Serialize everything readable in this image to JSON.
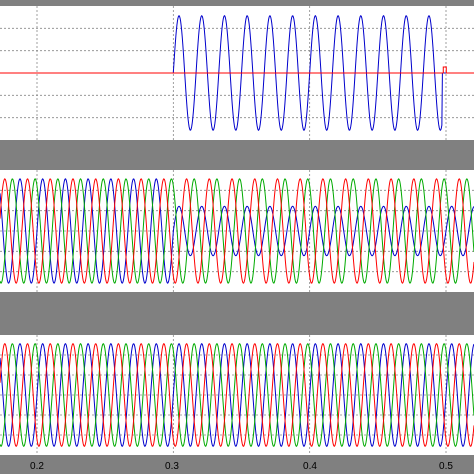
{
  "chart_data": [
    {
      "type": "line",
      "panel": "top",
      "title": "",
      "xlabel": "",
      "ylabel": "",
      "xlim": [
        0.145,
        0.53
      ],
      "ylim": [
        -1,
        1
      ],
      "grid": true,
      "series": [
        {
          "color": "#0000cc",
          "kind": "burst-sine",
          "start": 0.3,
          "end": 0.497,
          "freq_hz": 60,
          "amplitude": 0.95,
          "baseline": 0.0
        },
        {
          "color": "#ff0000",
          "kind": "step",
          "level": 0.0,
          "step_at": 0.498,
          "step_to": 0.1
        }
      ]
    },
    {
      "type": "line",
      "panel": "middle",
      "title": "",
      "xlabel": "",
      "ylabel": "",
      "xlim": [
        0.145,
        0.53
      ],
      "ylim": [
        -1,
        1
      ],
      "grid": true,
      "series": [
        {
          "color": "#0000cc",
          "kind": "sine",
          "freq_hz": 60,
          "amplitude": 0.95,
          "phase_deg": 0,
          "reduced_from": 0.3,
          "reduced_amplitude": 0.45
        },
        {
          "color": "#00aa00",
          "kind": "sine",
          "freq_hz": 60,
          "amplitude": 0.95,
          "phase_deg": 120
        },
        {
          "color": "#ff0000",
          "kind": "sine",
          "freq_hz": 60,
          "amplitude": 0.95,
          "phase_deg": -120
        }
      ]
    },
    {
      "type": "line",
      "panel": "bottom",
      "title": "",
      "xlabel": "",
      "ylabel": "",
      "xlim": [
        0.145,
        0.53
      ],
      "ylim": [
        -1,
        1
      ],
      "grid": true,
      "x_ticks": [
        "0.2",
        "0.3",
        "0.4",
        "0.5"
      ],
      "series": [
        {
          "color": "#0000cc",
          "kind": "sine",
          "freq_hz": 60,
          "amplitude": 0.95,
          "phase_deg": 0
        },
        {
          "color": "#00aa00",
          "kind": "sine",
          "freq_hz": 60,
          "amplitude": 0.95,
          "phase_deg": 120
        },
        {
          "color": "#ff0000",
          "kind": "sine",
          "freq_hz": 60,
          "amplitude": 0.95,
          "phase_deg": -120
        }
      ]
    }
  ],
  "colors": {
    "separator": "#808080",
    "plot_bg": "#ffffff",
    "grid": "#888888",
    "tick_label": "#000000"
  }
}
